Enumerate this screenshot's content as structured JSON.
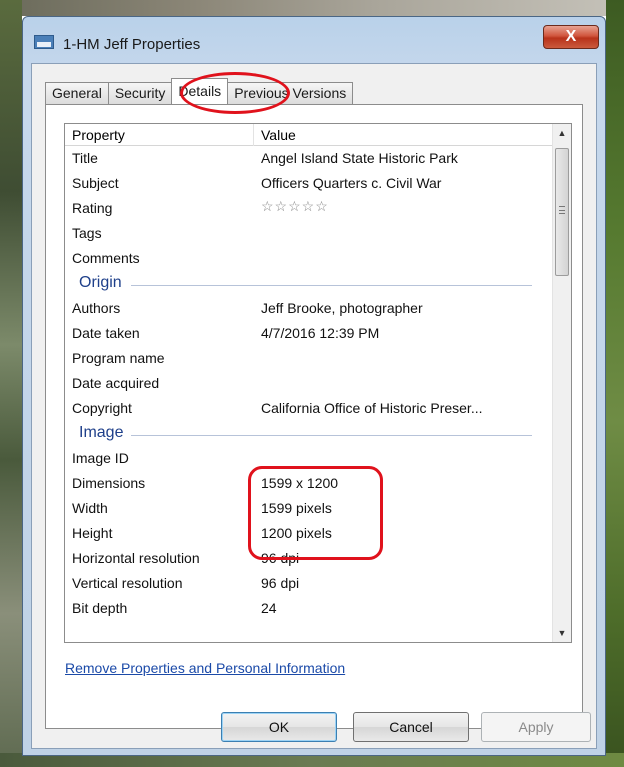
{
  "window": {
    "title": "1-HM Jeff Properties",
    "close_label": "X"
  },
  "tabs": [
    {
      "label": "General"
    },
    {
      "label": "Security"
    },
    {
      "label": "Details",
      "active": true
    },
    {
      "label": "Previous Versions"
    }
  ],
  "list": {
    "header_property": "Property",
    "header_value": "Value",
    "rows_top": [
      {
        "prop": "Title",
        "val": "Angel Island State Historic Park"
      },
      {
        "prop": "Subject",
        "val": "Officers Quarters c. Civil War"
      },
      {
        "prop": "Rating",
        "val": ""
      },
      {
        "prop": "Tags",
        "val": ""
      },
      {
        "prop": "Comments",
        "val": ""
      }
    ],
    "rating_stars": "☆☆☆☆☆",
    "group_origin": "Origin",
    "rows_origin": [
      {
        "prop": "Authors",
        "val": "Jeff Brooke, photographer"
      },
      {
        "prop": "Date taken",
        "val": "4/7/2016 12:39 PM"
      },
      {
        "prop": "Program name",
        "val": ""
      },
      {
        "prop": "Date acquired",
        "val": ""
      },
      {
        "prop": "Copyright",
        "val": "California Office of Historic Preser..."
      }
    ],
    "group_image": "Image",
    "rows_image": [
      {
        "prop": "Image ID",
        "val": ""
      },
      {
        "prop": "Dimensions",
        "val": "1599 x 1200"
      },
      {
        "prop": "Width",
        "val": "1599 pixels"
      },
      {
        "prop": "Height",
        "val": "1200 pixels"
      },
      {
        "prop": "Horizontal resolution",
        "val": "96 dpi"
      },
      {
        "prop": "Vertical resolution",
        "val": "96 dpi"
      },
      {
        "prop": "Bit depth",
        "val": "24"
      }
    ]
  },
  "remove_link": "Remove Properties and Personal Information",
  "buttons": {
    "ok": "OK",
    "cancel": "Cancel",
    "apply": "Apply"
  },
  "colors": {
    "highlight": "#e0121c",
    "link": "#1b4aa8",
    "group_heading": "#1e3f8a"
  },
  "icons": [
    "window-icon",
    "scroll-up-icon",
    "scroll-down-icon"
  ]
}
